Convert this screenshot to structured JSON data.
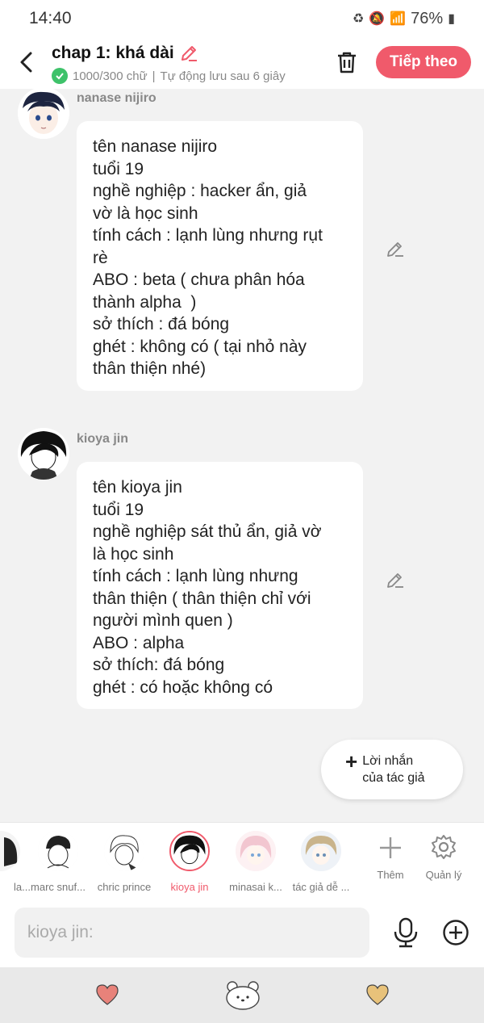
{
  "status_bar": {
    "time": "14:40",
    "battery": "76%"
  },
  "header": {
    "title": "chap 1: khá dài",
    "word_count": "1000/300 chữ",
    "autosave": "Tự động lưu sau 6 giây",
    "next_label": "Tiếp theo"
  },
  "messages": [
    {
      "name": "nanase nijiro",
      "text": "tên nanase nijiro\ntuổi 19\nnghề nghiệp : hacker ẩn, giả\nvờ là học sinh\ntính cách : lạnh lùng nhưng rụt\nrè\nABO : beta ( chưa phân hóa\nthành alpha  )\nsở thích : đá bóng\nghét : không có ( tại nhỏ này\nthân thiện nhé)"
    },
    {
      "name": "kioya jin",
      "text": "tên kioya jin\ntuổi 19\nnghề nghiệp sát thủ ẩn, giả vờ\nlà học sinh\ntính cách : lạnh lùng nhưng\nthân thiện ( thân thiện chỉ với\nngười mình quen )\nABO : alpha\nsở thích: đá bóng\nghét : có hoặc không có"
    }
  ],
  "author_note": {
    "label": "Lời nhắn\ncủa tác giả"
  },
  "characters": [
    {
      "label": "la..."
    },
    {
      "label": "marc snuf..."
    },
    {
      "label": "chric prince"
    },
    {
      "label": "kioya jin",
      "active": true
    },
    {
      "label": "minasai k..."
    },
    {
      "label": "tác giả dễ ..."
    }
  ],
  "tools": {
    "add_label": "Thêm",
    "manage_label": "Quản lý"
  },
  "composer": {
    "placeholder": "kioya jin:"
  },
  "colors": {
    "accent": "#f05a6b",
    "check": "#3ec26a",
    "heart_left": "#e8827a",
    "heart_right": "#e8c27a"
  },
  "icons": [
    "back-arrow-icon",
    "pencil-icon",
    "check-icon",
    "trash-icon",
    "edit-icon",
    "plus-icon",
    "gear-icon",
    "mic-icon",
    "add-circle-icon",
    "heart-icon",
    "bear-icon"
  ]
}
